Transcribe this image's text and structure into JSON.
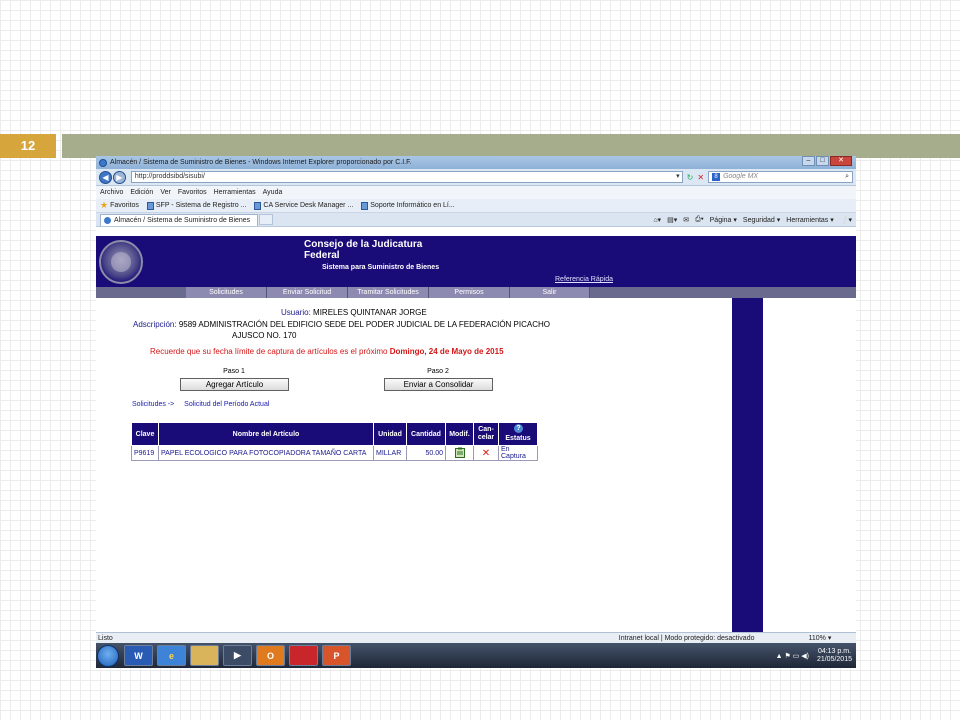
{
  "slide": {
    "number": "12"
  },
  "browser": {
    "title": "Almacén / Sistema de Suministro de Bienes - Windows Internet Explorer proporcionado por C.I.F.",
    "window_controls": [
      "–",
      "□",
      "✕"
    ],
    "url": "http://proddsibd/sisubi/",
    "search_placeholder": "Google MX",
    "search_engine_icon": "8",
    "menu": [
      "Archivo",
      "Edición",
      "Ver",
      "Favoritos",
      "Herramientas",
      "Ayuda"
    ],
    "favorites_label": "Favoritos",
    "favorites": [
      "SFP - Sistema de Registro ...",
      "CA Service Desk Manager ...",
      "Soporte Informático en Lí..."
    ],
    "tab_label": "Almacén / Sistema de Suministro de Bienes",
    "tools": [
      "Página ▾",
      "Seguridad ▾",
      "Herramientas ▾",
      "❔▾"
    ],
    "status_left": "Listo",
    "status_zone": "Intranet local | Modo protegido: desactivado",
    "zoom": "110% ▾"
  },
  "page": {
    "org_title": "Consejo de la Judicatura Federal",
    "system_title": "Sistema para Suministro de Bienes",
    "quick_ref": "Referencia Rápida",
    "nav": [
      "Solicitudes",
      "Enviar Solicitud",
      "Tramitar Solicitudes",
      "Permisos",
      "Salir"
    ],
    "user_label": "Usuario:",
    "user_name": "MIRELES QUINTANAR JORGE",
    "adscripcion_label": "Adscripción:",
    "adscripcion_value": "9589 ADMINISTRACIÓN DEL EDIFICIO SEDE DEL PODER JUDICIAL DE LA FEDERACIÓN PICACHO",
    "adscripcion_cont": "AJUSCO NO. 170",
    "reminder_text": "Recuerde que su fecha límite de captura de artículos es el próximo",
    "reminder_date": "Domingo, 24 de Mayo de 2015",
    "step1_label": "Paso 1",
    "step1_button": "Agregar Artículo",
    "step2_label": "Paso 2",
    "step2_button": "Enviar a Consolidar",
    "breadcrumb_root": "Solicitudes ->",
    "breadcrumb_current": "Solicitud del Período Actual",
    "table": {
      "headers": {
        "clave": "Clave",
        "nombre": "Nombre del Artículo",
        "unidad": "Unidad",
        "cantidad": "Cantidad",
        "modif": "Modif.",
        "cancelar": "Can-celar",
        "estatus": "Estatus"
      },
      "rows": [
        {
          "clave": "P9619",
          "nombre": "PAPEL ECOLOGICO PARA FOTOCOPIADORA TAMAÑO CARTA",
          "unidad": "MILLAR",
          "cantidad": "50.00",
          "cancel_mark": "✕",
          "estatus": "En Captura"
        }
      ]
    }
  },
  "taskbar": {
    "apps": [
      "W",
      "e",
      "",
      "▶",
      "O",
      "",
      "P"
    ],
    "tray_icons": "▲ ⚑ ▭ ◀)",
    "time": "04:13 p.m.",
    "date": "21/05/2015"
  }
}
